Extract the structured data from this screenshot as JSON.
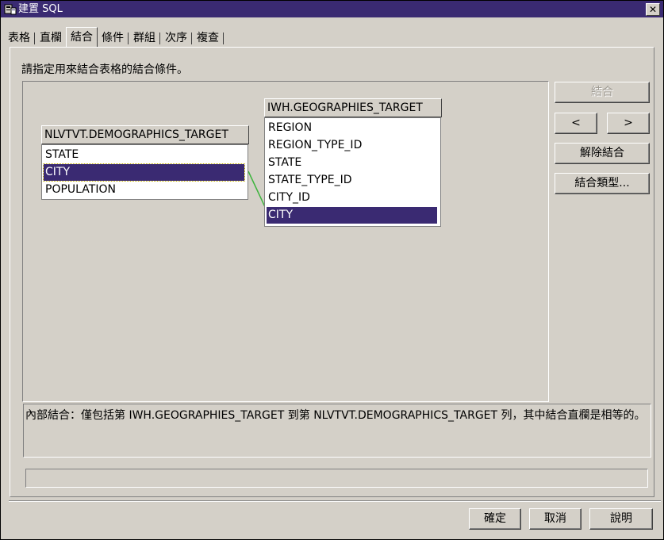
{
  "window": {
    "title": "建置 SQL",
    "close_label": "✕",
    "title_bar_color": "#3a2a72",
    "app_icon": "database-sql-icon"
  },
  "tabs": [
    {
      "label": "表格"
    },
    {
      "label": "直欄"
    },
    {
      "label": "結合"
    },
    {
      "label": "條件"
    },
    {
      "label": "群組"
    },
    {
      "label": "次序"
    },
    {
      "label": "複查"
    }
  ],
  "active_tab": "結合",
  "join": {
    "instruction": "請指定用來結合表格的結合條件。",
    "left_table": {
      "name": "NLVTVT.DEMOGRAPHICS_TARGET",
      "columns": [
        "STATE",
        "CITY",
        "POPULATION"
      ],
      "selected": "CITY"
    },
    "right_table": {
      "name": "IWH.GEOGRAPHIES_TARGET",
      "columns": [
        "REGION",
        "REGION_TYPE_ID",
        "STATE",
        "STATE_TYPE_ID",
        "CITY_ID",
        "CITY"
      ],
      "selected": "CITY"
    },
    "join_line_color": "#3cb43c",
    "selection_color": "#3a2a72",
    "buttons": {
      "join": "結合",
      "prev": "<",
      "next": ">",
      "unjoin": "解除結合",
      "join_type": "結合類型..."
    },
    "description": "內部結合：僅包括第 IWH.GEOGRAPHIES_TARGET 到第 NLVTVT.DEMOGRAPHICS_TARGET 列，其中結合直欄是相等的。"
  },
  "footer": {
    "ok": "確定",
    "cancel": "取消",
    "help": "說明"
  }
}
